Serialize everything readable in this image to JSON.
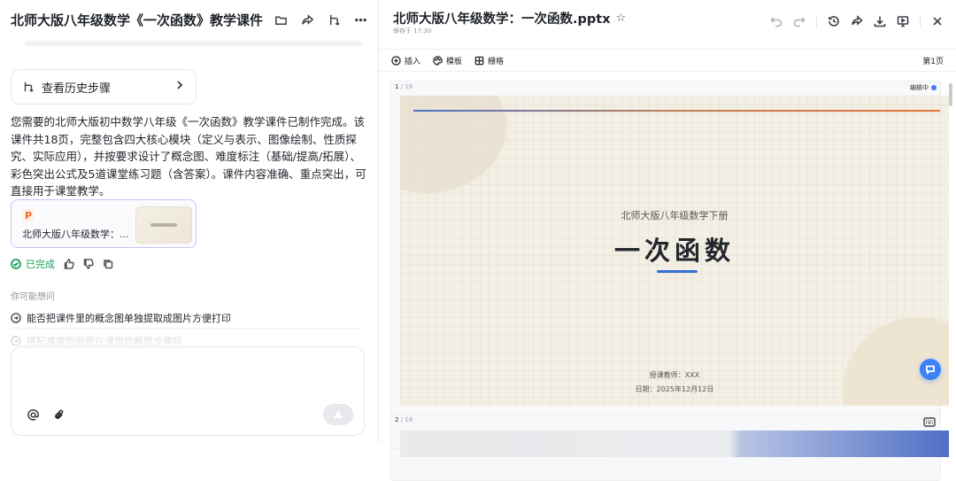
{
  "left": {
    "title": "北师大版八年级数学《一次函数》教学课件",
    "history_label": "查看历史步骤",
    "message": "您需要的北师大版初中数学八年级《一次函数》教学课件已制作完成。该课件共18页，完整包含四大核心模块（定义与表示、图像绘制、性质探究、实际应用），并按要求设计了概念图、难度标注（基础/提高/拓展）、彩色突出公式及5道课堂练习题（含答案）。课件内容准确、重点突出，可直接用于课堂教学。",
    "file": {
      "icon_letter": "P",
      "name": "北师大版八年级数学：..."
    },
    "status_done": "已完成",
    "suggest_title": "你可能想问",
    "suggestions": [
      "能否把课件里的概念图单独提取成图片方便打印",
      "搭配难度的例题在课堂的解题步骤吗"
    ]
  },
  "right": {
    "title": "北师大版八年级数学：一次函数.pptx",
    "saved": "保存于 17:30",
    "toolbar": {
      "insert": "插入",
      "template": "模板",
      "grid": "栅格",
      "page": "第1页"
    },
    "slide1": {
      "num": "1",
      "total": " / 18",
      "editing": "编辑中",
      "subtitle": "北师大版八年级数学下册",
      "title": "一次函数",
      "teacher": "授课教师：XXX",
      "date": "日期：2025年12月12日"
    },
    "slide2": {
      "num": "2",
      "total": " / 18"
    }
  },
  "colors": {
    "accent": "#3470d6",
    "done": "#1aa15a",
    "fab": "#3b82f6",
    "ppt": "#f26b2a"
  }
}
